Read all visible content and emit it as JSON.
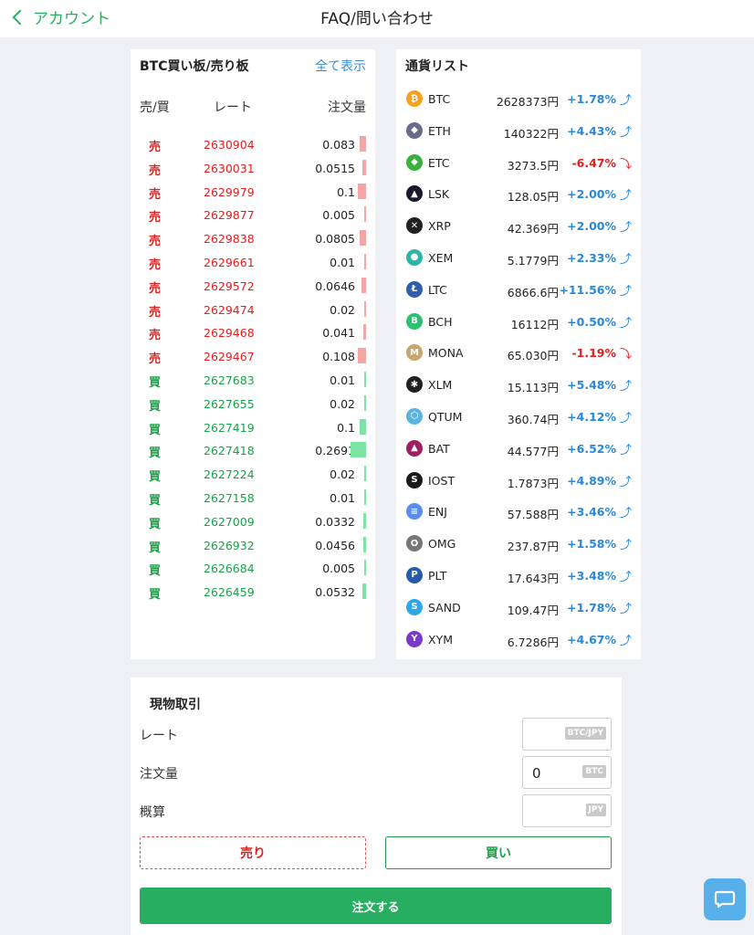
{
  "header": {
    "back_label": "アカウント",
    "title": "FAQ/問い合わせ"
  },
  "orderbook": {
    "title": "BTC買い板/売り板",
    "show_all": "全て表示",
    "col_side": "売/買",
    "col_rate": "レート",
    "col_qty": "注文量",
    "rows": [
      {
        "side": "売",
        "rate": "2630904",
        "qty": "0.083",
        "type": "sell",
        "level": 0.4
      },
      {
        "side": "売",
        "rate": "2630031",
        "qty": "0.0515",
        "type": "sell",
        "level": 0.25
      },
      {
        "side": "売",
        "rate": "2629979",
        "qty": "0.1",
        "type": "sell",
        "level": 0.5
      },
      {
        "side": "売",
        "rate": "2629877",
        "qty": "0.005",
        "type": "sell",
        "level": 0.03
      },
      {
        "side": "売",
        "rate": "2629838",
        "qty": "0.0805",
        "type": "sell",
        "level": 0.4
      },
      {
        "side": "売",
        "rate": "2629661",
        "qty": "0.01",
        "type": "sell",
        "level": 0.05
      },
      {
        "side": "売",
        "rate": "2629572",
        "qty": "0.0646",
        "type": "sell",
        "level": 0.3
      },
      {
        "side": "売",
        "rate": "2629474",
        "qty": "0.02",
        "type": "sell",
        "level": 0.1
      },
      {
        "side": "売",
        "rate": "2629468",
        "qty": "0.041",
        "type": "sell",
        "level": 0.2
      },
      {
        "side": "売",
        "rate": "2629467",
        "qty": "0.108",
        "type": "sell",
        "level": 0.5
      },
      {
        "side": "買",
        "rate": "2627683",
        "qty": "0.01",
        "type": "buy",
        "level": 0.05
      },
      {
        "side": "買",
        "rate": "2627655",
        "qty": "0.02",
        "type": "buy",
        "level": 0.1
      },
      {
        "side": "買",
        "rate": "2627419",
        "qty": "0.1",
        "type": "buy",
        "level": 0.4
      },
      {
        "side": "買",
        "rate": "2627418",
        "qty": "0.2691",
        "type": "buy",
        "level": 1.0
      },
      {
        "side": "買",
        "rate": "2627224",
        "qty": "0.02",
        "type": "buy",
        "level": 0.1
      },
      {
        "side": "買",
        "rate": "2627158",
        "qty": "0.01",
        "type": "buy",
        "level": 0.05
      },
      {
        "side": "買",
        "rate": "2627009",
        "qty": "0.0332",
        "type": "buy",
        "level": 0.15
      },
      {
        "side": "買",
        "rate": "2626932",
        "qty": "0.0456",
        "type": "buy",
        "level": 0.2
      },
      {
        "side": "買",
        "rate": "2626684",
        "qty": "0.005",
        "type": "buy",
        "level": 0.03
      },
      {
        "side": "買",
        "rate": "2626459",
        "qty": "0.0532",
        "type": "buy",
        "level": 0.25
      }
    ]
  },
  "currency_list": {
    "title": "通貨リスト",
    "rows": [
      {
        "sym": "BTC",
        "price": "2628373円",
        "chg": "+1.78%",
        "dir": "up",
        "icon": "bitcoin-icon",
        "color": "#f7a21b",
        "glyph": "₿"
      },
      {
        "sym": "ETH",
        "price": "140322円",
        "chg": "+4.43%",
        "dir": "up",
        "icon": "ethereum-icon",
        "color": "#6b6b8a",
        "glyph": "◆"
      },
      {
        "sym": "ETC",
        "price": "3273.5円",
        "chg": "-6.47%",
        "dir": "down",
        "icon": "ethereum-classic-icon",
        "color": "#3ab03e",
        "glyph": "◆"
      },
      {
        "sym": "LSK",
        "price": "128.05円",
        "chg": "+2.00%",
        "dir": "up",
        "icon": "lisk-icon",
        "color": "#1a1a2e",
        "glyph": "▲"
      },
      {
        "sym": "XRP",
        "price": "42.369円",
        "chg": "+2.00%",
        "dir": "up",
        "icon": "ripple-icon",
        "color": "#222222",
        "glyph": "✕"
      },
      {
        "sym": "XEM",
        "price": "5.1779円",
        "chg": "+2.33%",
        "dir": "up",
        "icon": "nem-icon",
        "color": "#2fb4a8",
        "glyph": "●"
      },
      {
        "sym": "LTC",
        "price": "6866.6円",
        "chg": "+11.56%",
        "dir": "up",
        "icon": "litecoin-icon",
        "color": "#2f5eaa",
        "glyph": "Ł"
      },
      {
        "sym": "BCH",
        "price": "16112円",
        "chg": "+0.50%",
        "dir": "up",
        "icon": "bitcoin-cash-icon",
        "color": "#2fbf71",
        "glyph": "B"
      },
      {
        "sym": "MONA",
        "price": "65.030円",
        "chg": "-1.19%",
        "dir": "down",
        "icon": "monacoin-icon",
        "color": "#c9a66b",
        "glyph": "M"
      },
      {
        "sym": "XLM",
        "price": "15.113円",
        "chg": "+5.48%",
        "dir": "up",
        "icon": "stellar-icon",
        "color": "#222222",
        "glyph": "✱"
      },
      {
        "sym": "QTUM",
        "price": "360.74円",
        "chg": "+4.12%",
        "dir": "up",
        "icon": "qtum-icon",
        "color": "#5bb4e0",
        "glyph": "⬡"
      },
      {
        "sym": "BAT",
        "price": "44.577円",
        "chg": "+6.52%",
        "dir": "up",
        "icon": "bat-icon",
        "color": "#9e1f63",
        "glyph": "▲"
      },
      {
        "sym": "IOST",
        "price": "1.7873円",
        "chg": "+4.89%",
        "dir": "up",
        "icon": "iost-icon",
        "color": "#1a1a1a",
        "glyph": "S"
      },
      {
        "sym": "ENJ",
        "price": "57.588円",
        "chg": "+3.46%",
        "dir": "up",
        "icon": "enjin-icon",
        "color": "#5a8dee",
        "glyph": "≡"
      },
      {
        "sym": "OMG",
        "price": "237.87円",
        "chg": "+1.58%",
        "dir": "up",
        "icon": "omg-icon",
        "color": "#777777",
        "glyph": "O"
      },
      {
        "sym": "PLT",
        "price": "17.643円",
        "chg": "+3.48%",
        "dir": "up",
        "icon": "palette-icon",
        "color": "#2a5ba8",
        "glyph": "P"
      },
      {
        "sym": "SAND",
        "price": "109.47円",
        "chg": "+1.78%",
        "dir": "up",
        "icon": "sandbox-icon",
        "color": "#2ea8e6",
        "glyph": "S"
      },
      {
        "sym": "XYM",
        "price": "6.7286円",
        "chg": "+4.67%",
        "dir": "up",
        "icon": "symbol-icon",
        "color": "#7a3ac8",
        "glyph": "Y"
      }
    ]
  },
  "trade": {
    "title": "現物取引",
    "rate_label": "レート",
    "qty_label": "注文量",
    "est_label": "概算",
    "rate_value": "",
    "qty_value": "0",
    "est_value": "",
    "rate_unit": "BTC/JPY",
    "qty_unit": "BTC",
    "est_unit": "JPY",
    "sell_label": "売り",
    "buy_label": "買い",
    "order_label": "注文する"
  }
}
